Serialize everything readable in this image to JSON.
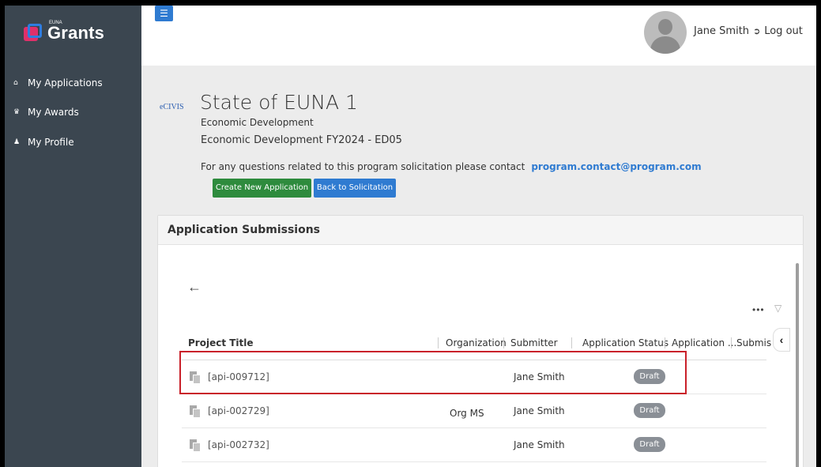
{
  "sidebar": {
    "logo_small": "EUNA",
    "logo_text": "Grants",
    "items": [
      {
        "label": "My Applications",
        "icon": "home-icon"
      },
      {
        "label": "My Awards",
        "icon": "trophy-icon"
      },
      {
        "label": "My Profile",
        "icon": "user-icon"
      }
    ]
  },
  "topbar": {
    "user_name": "Jane Smith",
    "logout_label": "Log out"
  },
  "header": {
    "ecivis_label": "eCIVIS",
    "org_title": "State of EUNA 1",
    "program_name": "Economic Development",
    "solicitation": "Economic Development FY2024 - ED05",
    "contact_text": "For any questions related to this program solicitation please contact",
    "contact_email": "program.contact@program.com",
    "create_button": "Create New Application",
    "back_button": "Back to Solicitation"
  },
  "panel": {
    "title": "Application Submissions",
    "columns": [
      "Project Title",
      "Organization",
      "Submitter",
      "Application Status",
      "Application ...",
      "Submis"
    ],
    "rows": [
      {
        "title": "[api-009712]",
        "organization": "",
        "submitter": "Jane Smith",
        "status": "Draft"
      },
      {
        "title": "[api-002729]",
        "organization": "Org MS",
        "submitter": "Jane Smith",
        "status": "Draft"
      },
      {
        "title": "[api-002732]",
        "organization": "",
        "submitter": "Jane Smith",
        "status": "Draft"
      }
    ]
  },
  "colors": {
    "sidebar_bg": "#3b4650",
    "primary": "#2f7bd1",
    "success": "#2e8b3d",
    "highlight": "#c9202a",
    "badge": "#8a8f96"
  }
}
